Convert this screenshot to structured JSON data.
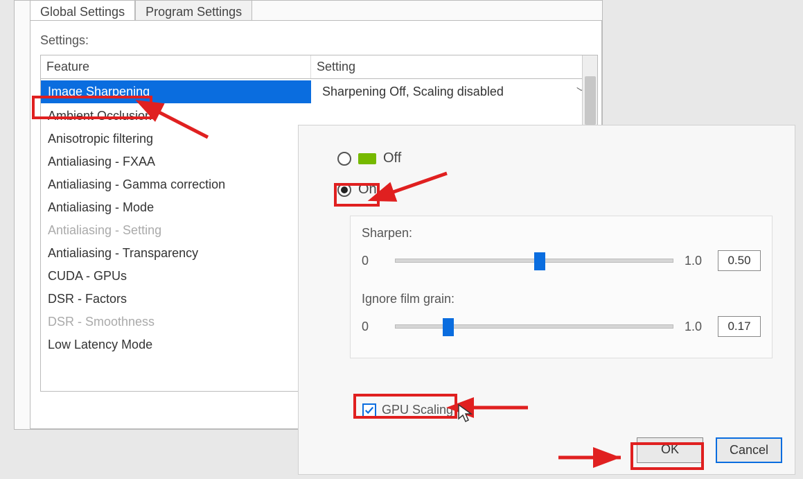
{
  "tabs": {
    "global": "Global Settings",
    "program": "Program Settings"
  },
  "settings_label": "Settings:",
  "columns": {
    "feature": "Feature",
    "setting": "Setting"
  },
  "features": [
    {
      "label": "Image Sharpening",
      "selected": true
    },
    {
      "label": "Ambient Occlusion"
    },
    {
      "label": "Anisotropic filtering"
    },
    {
      "label": "Antialiasing - FXAA"
    },
    {
      "label": "Antialiasing - Gamma correction"
    },
    {
      "label": "Antialiasing - Mode"
    },
    {
      "label": "Antialiasing - Setting",
      "disabled": true
    },
    {
      "label": "Antialiasing - Transparency"
    },
    {
      "label": "CUDA - GPUs"
    },
    {
      "label": "DSR - Factors"
    },
    {
      "label": "DSR - Smoothness",
      "disabled": true
    },
    {
      "label": "Low Latency Mode"
    }
  ],
  "selected_setting_value": "Sharpening Off, Scaling disabled",
  "popup": {
    "off": "Off",
    "on": "On",
    "sharpen_label": "Sharpen:",
    "sharpen_min": "0",
    "sharpen_max": "1.0",
    "sharpen_value": "0.50",
    "grain_label": "Ignore film grain:",
    "grain_min": "0",
    "grain_max": "1.0",
    "grain_value": "0.17",
    "gpu_scaling": "GPU Scaling",
    "ok": "OK",
    "cancel": "Cancel"
  }
}
